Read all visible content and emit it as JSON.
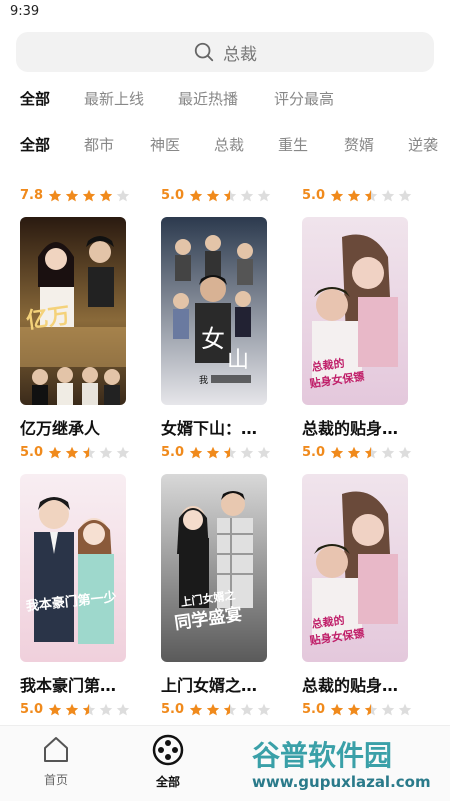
{
  "status": {
    "time": "9:39"
  },
  "search": {
    "placeholder": "总裁"
  },
  "sort_tabs": [
    "全部",
    "最新上线",
    "最近热播",
    "评分最高"
  ],
  "category_tabs": [
    "全部",
    "都市",
    "神医",
    "总裁",
    "重生",
    "赘婿",
    "逆袭"
  ],
  "top_ratings": [
    {
      "score": "7.8",
      "stars": 4
    },
    {
      "score": "5.0",
      "stars": 2.5
    },
    {
      "score": "5.0",
      "stars": 2.5
    }
  ],
  "cards": [
    {
      "title": "亿万继承人",
      "score": "5.0",
      "stars": 2.5,
      "poster_text": "亿万继承人"
    },
    {
      "title": "女婿下山：…",
      "score": "5.0",
      "stars": 2.5,
      "poster_text": "女婿下山"
    },
    {
      "title": "总裁的贴身…",
      "score": "5.0",
      "stars": 2.5,
      "poster_text": "总裁的贴身女保镖"
    },
    {
      "title": "我本豪门第…",
      "score": "5.0",
      "stars": 2.5,
      "poster_text": "我本豪门第一少"
    },
    {
      "title": "上门女婿之…",
      "score": "5.0",
      "stars": 2.5,
      "poster_text": "同学盛宴"
    },
    {
      "title": "总裁的贴身…",
      "score": "5.0",
      "stars": 2.5,
      "poster_text": "总裁的贴身女保镖"
    }
  ],
  "bottom_nav": {
    "home": "首页",
    "all": "全部"
  },
  "watermark": {
    "title": "谷普软件园",
    "url": "www.gupuxlazal.com"
  },
  "colors": {
    "accent": "#f08a1c",
    "star_off": "#dddddd"
  }
}
